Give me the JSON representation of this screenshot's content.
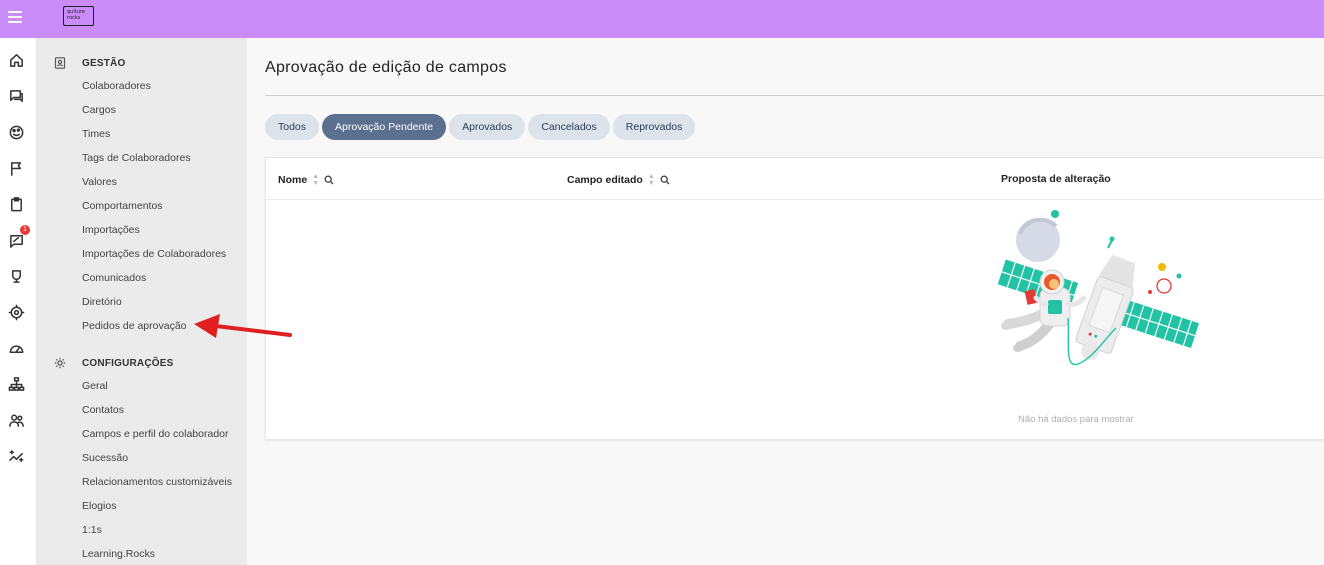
{
  "app": {
    "logo_text_1": "qulture",
    "logo_text_2": "rocks"
  },
  "rail": {
    "icons": [
      "home-icon",
      "chat-icon",
      "palette-icon",
      "flag-icon",
      "clipboard-icon",
      "feedback-icon",
      "award-icon",
      "target-icon",
      "gauge-icon",
      "org-chart-icon",
      "people-icon",
      "sparkle-chart-icon"
    ],
    "badge": "1"
  },
  "sidebar": {
    "gestao": {
      "title": "GESTÃO",
      "items": [
        "Colaboradores",
        "Cargos",
        "Times",
        "Tags de Colaboradores",
        "Valores",
        "Comportamentos",
        "Importações",
        "Importações de Colaboradores",
        "Comunicados",
        "Diretório",
        "Pedidos de aprovação"
      ]
    },
    "config": {
      "title": "CONFIGURAÇÕES",
      "items": [
        "Geral",
        "Contatos",
        "Campos e perfil do colaborador",
        "Sucessão",
        "Relacionamentos customizáveis",
        "Elogios",
        "1:1s",
        "Learning.Rocks"
      ]
    }
  },
  "main": {
    "title": "Aprovação de edição de campos",
    "tabs": [
      {
        "label": "Todos",
        "active": false
      },
      {
        "label": "Aprovação Pendente",
        "active": true
      },
      {
        "label": "Aprovados",
        "active": false
      },
      {
        "label": "Cancelados",
        "active": false
      },
      {
        "label": "Reprovados",
        "active": false
      }
    ],
    "table": {
      "columns": [
        "Nome",
        "Campo editado",
        "Proposta de alteração"
      ],
      "empty_text": "Não há dados para mostrar"
    }
  },
  "colors": {
    "topbar": "#c98cf9",
    "active_tab": "#5b6f8f",
    "tab": "#dde3ea",
    "arrow": "#e02020"
  }
}
